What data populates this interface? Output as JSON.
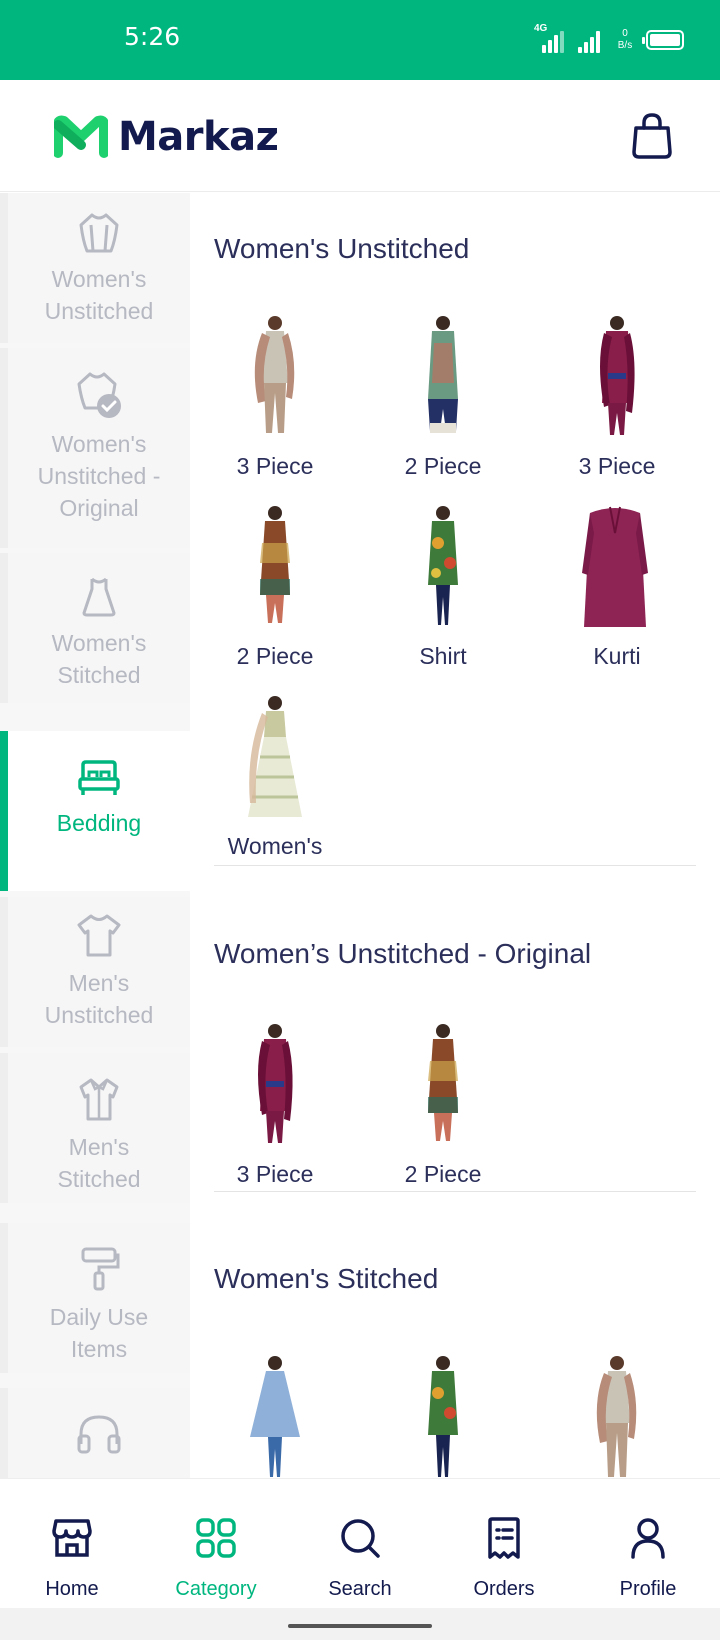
{
  "status_bar": {
    "time": "5:26",
    "network": "4G",
    "speed_top": "0",
    "speed_bottom": "B/s"
  },
  "header": {
    "brand": "Markaz",
    "cart_icon": "shopping-bag-icon"
  },
  "colors": {
    "brand": "#00b67f",
    "text_dark": "#131a4d",
    "muted": "#b6b8c2"
  },
  "sidebar": {
    "items": [
      {
        "label_lines": [
          "Women's",
          "Unstitched"
        ],
        "icon": "dress-icon"
      },
      {
        "label_lines": [
          "Women's",
          "Unstitched -",
          "Original"
        ],
        "icon": "verified-dress-icon"
      },
      {
        "label_lines": [
          "Women's",
          "Stitched"
        ],
        "icon": "frock-icon"
      },
      {
        "label_lines": [
          "Bedding"
        ],
        "icon": "bed-icon",
        "active": true
      },
      {
        "label_lines": [
          "Men's",
          "Unstitched"
        ],
        "icon": "tshirt-icon"
      },
      {
        "label_lines": [
          "Men's",
          "Stitched"
        ],
        "icon": "shirt-icon"
      },
      {
        "label_lines": [
          "Daily Use",
          "Items"
        ],
        "icon": "paint-roller-icon"
      },
      {
        "label_lines": [],
        "icon": "headphones-icon"
      }
    ]
  },
  "sections": [
    {
      "title": "Women's Unstitched",
      "products": [
        "3 Piece",
        "2 Piece",
        "3 Piece",
        "2 Piece",
        "Shirt",
        "Kurti",
        "Women's"
      ]
    },
    {
      "title": "Women’s Unstitched - Original",
      "products": [
        "3 Piece",
        "2 Piece"
      ]
    },
    {
      "title": "Women's Stitched",
      "products": [
        "",
        "",
        ""
      ]
    }
  ],
  "bottom_nav": {
    "items": [
      {
        "label": "Home",
        "icon": "store-icon"
      },
      {
        "label": "Category",
        "icon": "grid-icon",
        "active": true
      },
      {
        "label": "Search",
        "icon": "search-icon"
      },
      {
        "label": "Orders",
        "icon": "receipt-icon"
      },
      {
        "label": "Profile",
        "icon": "user-icon"
      }
    ]
  }
}
